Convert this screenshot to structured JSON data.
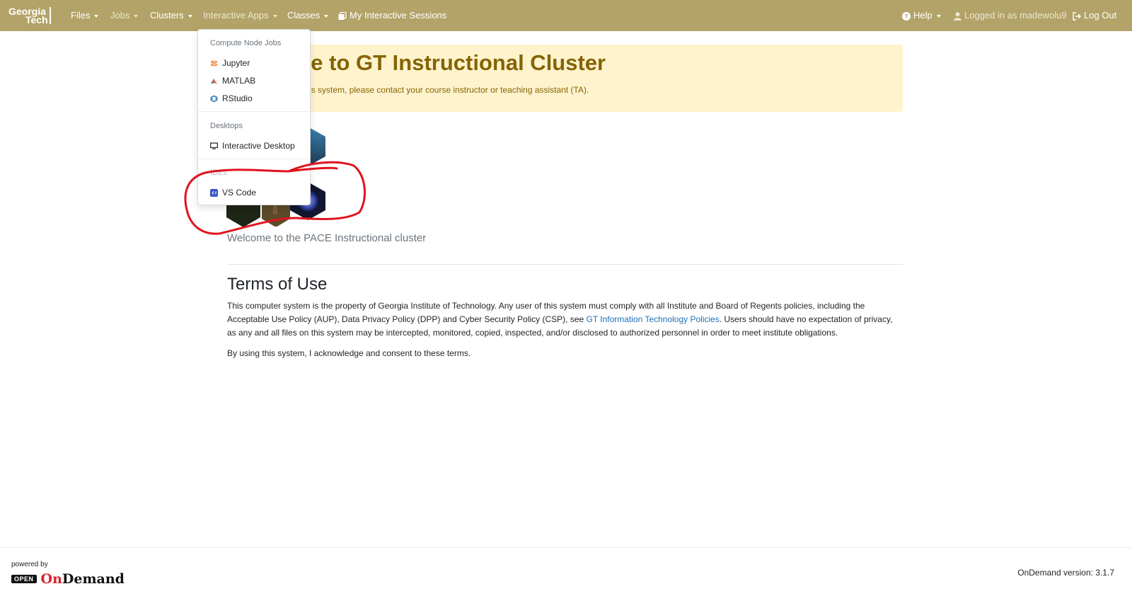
{
  "navbar": {
    "brand_line1": "Georgia",
    "brand_line2": "Tech",
    "files": "Files",
    "jobs": "Jobs",
    "clusters": "Clusters",
    "interactive_apps": "Interactive Apps",
    "classes": "Classes",
    "my_sessions": "My Interactive Sessions",
    "help": "Help",
    "logged_in": "Logged in as madewolu9",
    "logout": "Log Out",
    "color": "#b3a369"
  },
  "dropdown": {
    "sections": [
      {
        "header": "Compute Node Jobs",
        "items": [
          {
            "label": "Jupyter",
            "icon": "jupyter-icon"
          },
          {
            "label": "MATLAB",
            "icon": "matlab-icon"
          },
          {
            "label": "RStudio",
            "icon": "rstudio-icon"
          }
        ]
      },
      {
        "header": "Desktops",
        "items": [
          {
            "label": "Interactive Desktop",
            "icon": "monitor-icon"
          }
        ]
      },
      {
        "header": "IDEs",
        "items": [
          {
            "label": "VS Code",
            "icon": "vscode-icon"
          }
        ]
      }
    ]
  },
  "main": {
    "alert_title": "Welcome to GT Instructional Cluster",
    "alert_text": "For assistance with this system, please contact your course instructor or teaching assistant (TA).",
    "welcome_text": "Welcome to the PACE Instructional cluster",
    "terms_title": "Terms of Use",
    "terms_part1": "This computer system is the property of Georgia Institute of Technology. Any user of this system must comply with all Institute and Board of Regents policies, including the Acceptable Use Policy (AUP), Data Privacy Policy (DPP) and Cyber Security Policy (CSP), see ",
    "terms_link": "GT Information Technology Policies",
    "terms_part2": ". Users should have no expectation of privacy, as any and all files on this system may be intercepted, monitored, copied, inspected, and/or disclosed to authorized personnel in order to meet institute obligations.",
    "consent": "By using this system, I acknowledge and consent to these terms."
  },
  "footer": {
    "powered_by": "powered by",
    "open": "OPEN",
    "ondemand_prefix": "On",
    "ondemand_suffix": "Demand",
    "version": "OnDemand version: 3.1.7"
  },
  "annotation": {
    "color": "#e0141e"
  }
}
